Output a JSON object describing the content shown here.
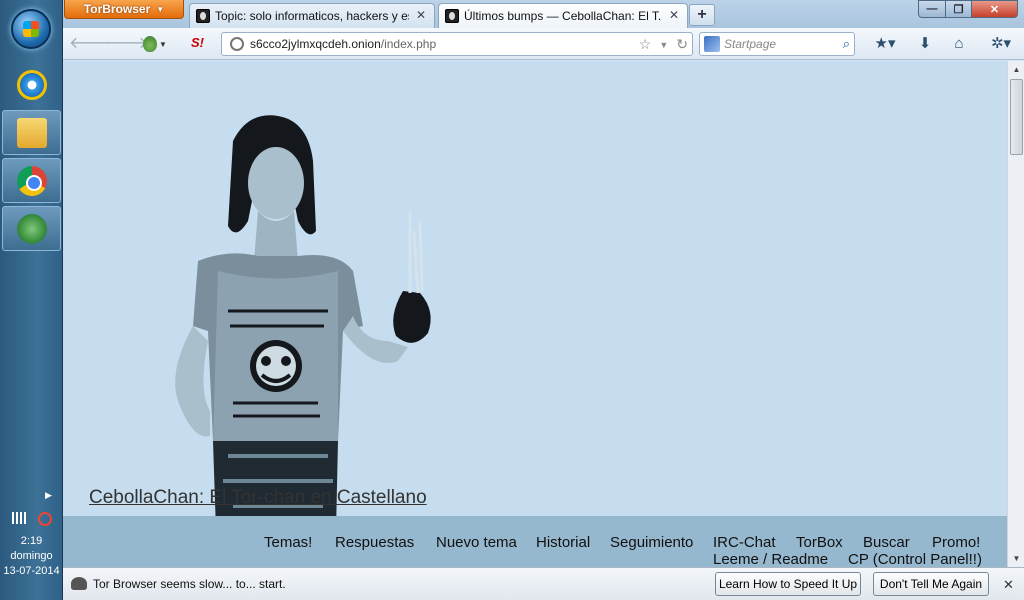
{
  "taskbar": {
    "apps": [
      "Internet Explorer",
      "Windows Explorer",
      "Google Chrome",
      "Tor Browser"
    ],
    "clock": {
      "time": "2:19",
      "day": "domingo",
      "date": "13-07-2014"
    }
  },
  "browser": {
    "app_button_label": "TorBrowser",
    "tabs": [
      {
        "title": "Topic: solo informaticos, hackers y es...",
        "selected": false
      },
      {
        "title": "Últimos bumps — CebollaChan: El T...",
        "selected": true
      }
    ],
    "new_tab_label": "+",
    "url": {
      "host": "s6cco2jylmxqcdeh.onion",
      "path": "/index.php"
    },
    "search": {
      "placeholder": "Startpage"
    }
  },
  "page": {
    "site_title": "CebollaChan: El Tor-chan en Castellano",
    "menu_row1": [
      "Temas!",
      "Respuestas",
      "Nuevo tema",
      "Historial",
      "Seguimiento",
      "IRC-Chat",
      "TorBox",
      "Buscar",
      "Promo!"
    ],
    "menu_row2": [
      "Leeme / Readme",
      "CP (Control Panel!!)"
    ],
    "background_color": "#c5ddee",
    "menu_bar_color": "#96b8cf"
  },
  "notification": {
    "text": "Tor Browser seems slow... to... start.",
    "learn_button": "Learn How to Speed It Up",
    "dont_button": "Don't Tell Me Again"
  }
}
